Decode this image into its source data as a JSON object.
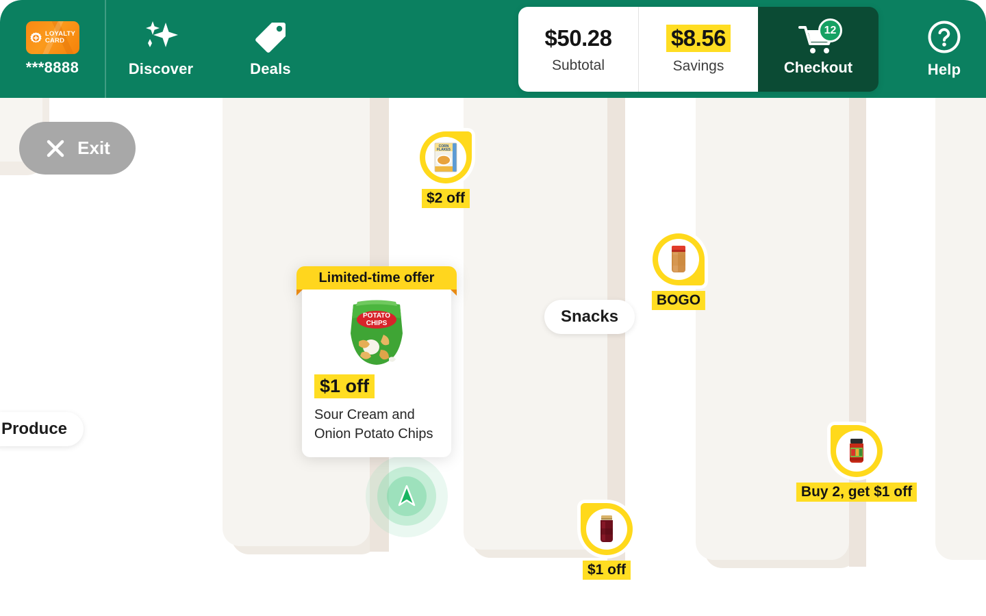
{
  "colors": {
    "brand_green": "#0b8060",
    "checkout_green": "#0b4b34",
    "accent_yellow": "#ffdd22",
    "pin_yellow": "#ffd91b",
    "aisle_beige": "#f6f4f0",
    "shelf_beige": "#ece4dc",
    "loyalty_orange": "#f98913",
    "exit_gray": "#a8a8a8"
  },
  "header": {
    "loyalty": {
      "icon": "loyalty-card-icon",
      "card_line1": "LOYALTY",
      "card_line2": "CARD",
      "card_number": "***8888"
    },
    "nav": [
      {
        "icon": "sparkles-icon",
        "label": "Discover"
      },
      {
        "icon": "price-tag-icon",
        "label": "Deals"
      }
    ],
    "summary": {
      "subtotal_value": "$50.28",
      "subtotal_label": "Subtotal",
      "savings_value": "$8.56",
      "savings_label": "Savings",
      "checkout_label": "Checkout",
      "checkout_icon": "shopping-cart-icon",
      "cart_count": "12"
    },
    "help": {
      "icon": "question-mark-circle-icon",
      "label": "Help"
    }
  },
  "exit_button": {
    "icon": "close-x-icon",
    "label": "Exit"
  },
  "map": {
    "aisle_labels": [
      {
        "name": "produce",
        "label": "Produce"
      },
      {
        "name": "snacks",
        "label": "Snacks"
      }
    ],
    "user_location": {
      "icon": "navigation-arrow-icon"
    }
  },
  "deal_pins": [
    {
      "name": "corn-flakes",
      "product_icon": "cereal-box-icon",
      "tag": "$2 off",
      "shape": "pin-tr"
    },
    {
      "name": "peanut-butter",
      "product_icon": "peanut-butter-jar-icon",
      "tag": "BOGO",
      "shape": "pin-br"
    },
    {
      "name": "salsa",
      "product_icon": "salsa-jar-icon",
      "tag": "Buy 2, get $1 off",
      "shape": "pin-tl"
    },
    {
      "name": "jam",
      "product_icon": "jam-jar-icon",
      "tag": "$1 off",
      "shape": "pin-tl"
    }
  ],
  "offer_card": {
    "ribbon": "Limited-time offer",
    "product_icon": "potato-chips-bag-icon",
    "discount": "$1 off",
    "description": "Sour Cream and Onion Potato Chips"
  }
}
